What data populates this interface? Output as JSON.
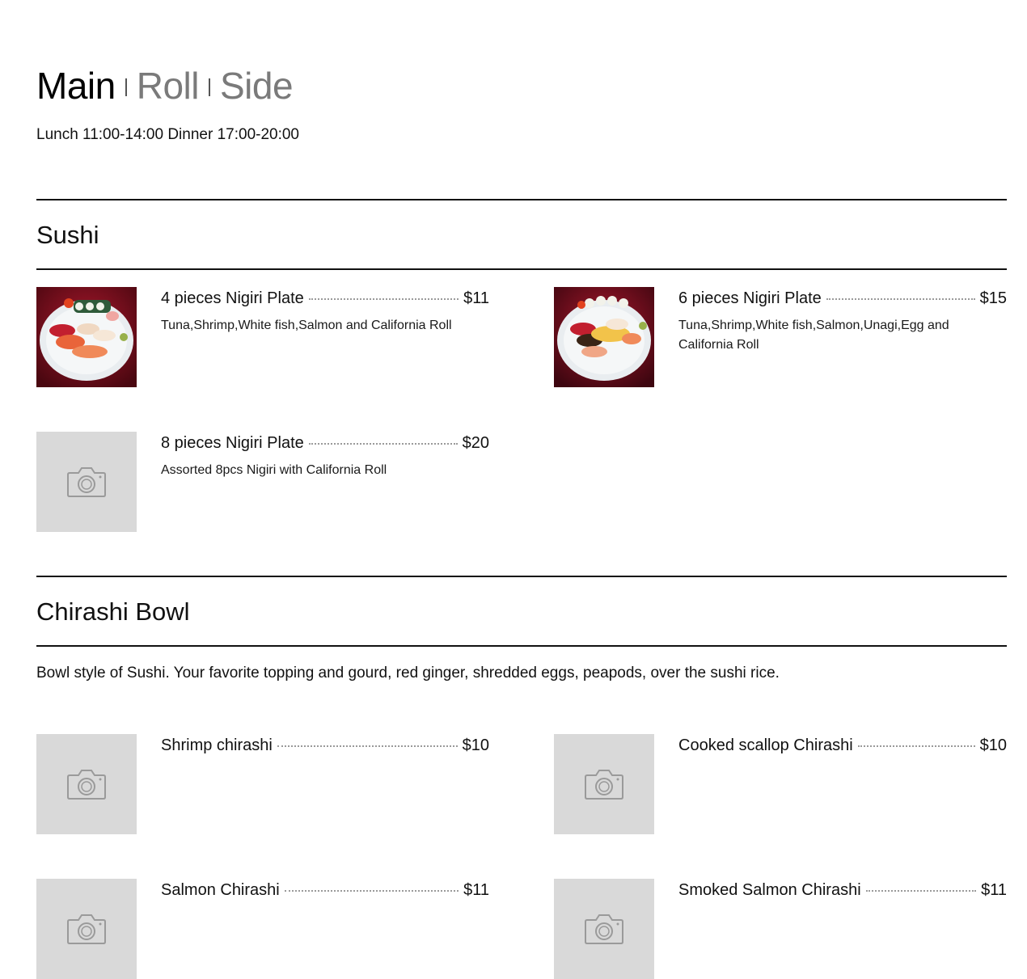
{
  "tabs": {
    "main": "Main",
    "roll": "Roll",
    "side": "Side"
  },
  "hours": "Lunch 11:00-14:00 Dinner 17:00-20:00",
  "sushi": {
    "title": "Sushi",
    "items": [
      {
        "name": "4 pieces Nigiri Plate",
        "price": "$11",
        "desc": "Tuna,Shrimp,White fish,Salmon and California Roll",
        "image": "sushi-plate-photo"
      },
      {
        "name": "6 pieces Nigiri Plate",
        "price": "$15",
        "desc": "Tuna,Shrimp,White fish,Salmon,Unagi,Egg and California Roll",
        "image": "sushi-plate-photo"
      },
      {
        "name": "8 pieces Nigiri Plate",
        "price": "$20",
        "desc": "Assorted 8pcs Nigiri with California Roll",
        "image": "camera-icon"
      }
    ]
  },
  "chirashi": {
    "title": "Chirashi Bowl",
    "desc": "Bowl style of Sushi. Your favorite topping and gourd, red ginger, shredded eggs, peapods, over the sushi rice.",
    "items": [
      {
        "name": "Shrimp chirashi",
        "price": "$10",
        "image": "camera-icon"
      },
      {
        "name": "Cooked scallop Chirashi",
        "price": "$10",
        "image": "camera-icon"
      },
      {
        "name": "Salmon Chirashi",
        "price": "$11",
        "image": "camera-icon"
      },
      {
        "name": "Smoked Salmon Chirashi",
        "price": "$11",
        "image": "camera-icon"
      }
    ]
  },
  "colors": {
    "text": "#111111",
    "inactive_tab": "#7a7a7a",
    "placeholder_bg": "#d9d9d9",
    "placeholder_icon": "#9a9a9a",
    "photo_background": "#7a0f1c"
  }
}
